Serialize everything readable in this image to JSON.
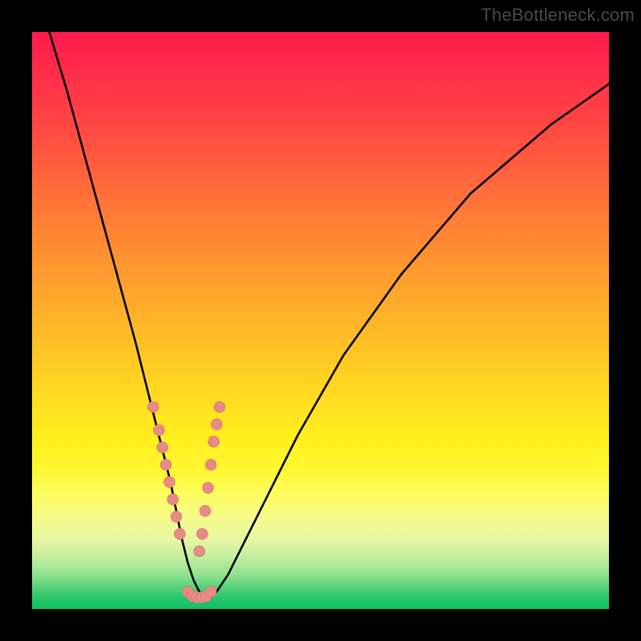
{
  "watermark": "TheBottleneck.com",
  "colors": {
    "curve_stroke": "#000000",
    "dot_fill": "#e88a86",
    "dot_stroke": "#d07570",
    "frame_bg": "#000000"
  },
  "chart_data": {
    "type": "line",
    "title": "",
    "xlabel": "",
    "ylabel": "",
    "xlim": [
      0,
      100
    ],
    "ylim": [
      0,
      100
    ],
    "grid": false,
    "legend": false,
    "note": "Bottleneck-style V-curve; x is relative component balance, y is severity (top=high). Values estimated from pixel geometry.",
    "series": [
      {
        "name": "bottleneck-curve",
        "x": [
          3,
          6,
          9,
          12,
          15,
          18,
          20,
          22,
          24,
          25,
          26,
          27,
          28,
          29,
          30,
          31,
          32,
          34,
          36,
          40,
          46,
          54,
          64,
          76,
          90,
          100
        ],
        "y": [
          100,
          90,
          79,
          68,
          57,
          46,
          38,
          30,
          22,
          17,
          12,
          8,
          5,
          3,
          2,
          2,
          3,
          6,
          10,
          18,
          30,
          44,
          58,
          72,
          84,
          91
        ]
      }
    ],
    "dots": {
      "name": "highlighted-points",
      "left_branch": [
        [
          21,
          35
        ],
        [
          22,
          31
        ],
        [
          22.6,
          28
        ],
        [
          23.2,
          25
        ],
        [
          23.8,
          22
        ],
        [
          24.4,
          19
        ],
        [
          25,
          16
        ],
        [
          25.6,
          13
        ]
      ],
      "right_branch": [
        [
          32.5,
          35
        ],
        [
          32,
          32
        ],
        [
          31.5,
          29
        ],
        [
          31,
          25
        ],
        [
          30.5,
          21
        ],
        [
          30,
          17
        ],
        [
          29.5,
          13
        ],
        [
          29,
          10
        ]
      ],
      "valley": [
        [
          27,
          3
        ],
        [
          27.8,
          2.2
        ],
        [
          28.6,
          2
        ],
        [
          29.4,
          2
        ],
        [
          30.2,
          2.2
        ],
        [
          31,
          3
        ]
      ]
    }
  }
}
